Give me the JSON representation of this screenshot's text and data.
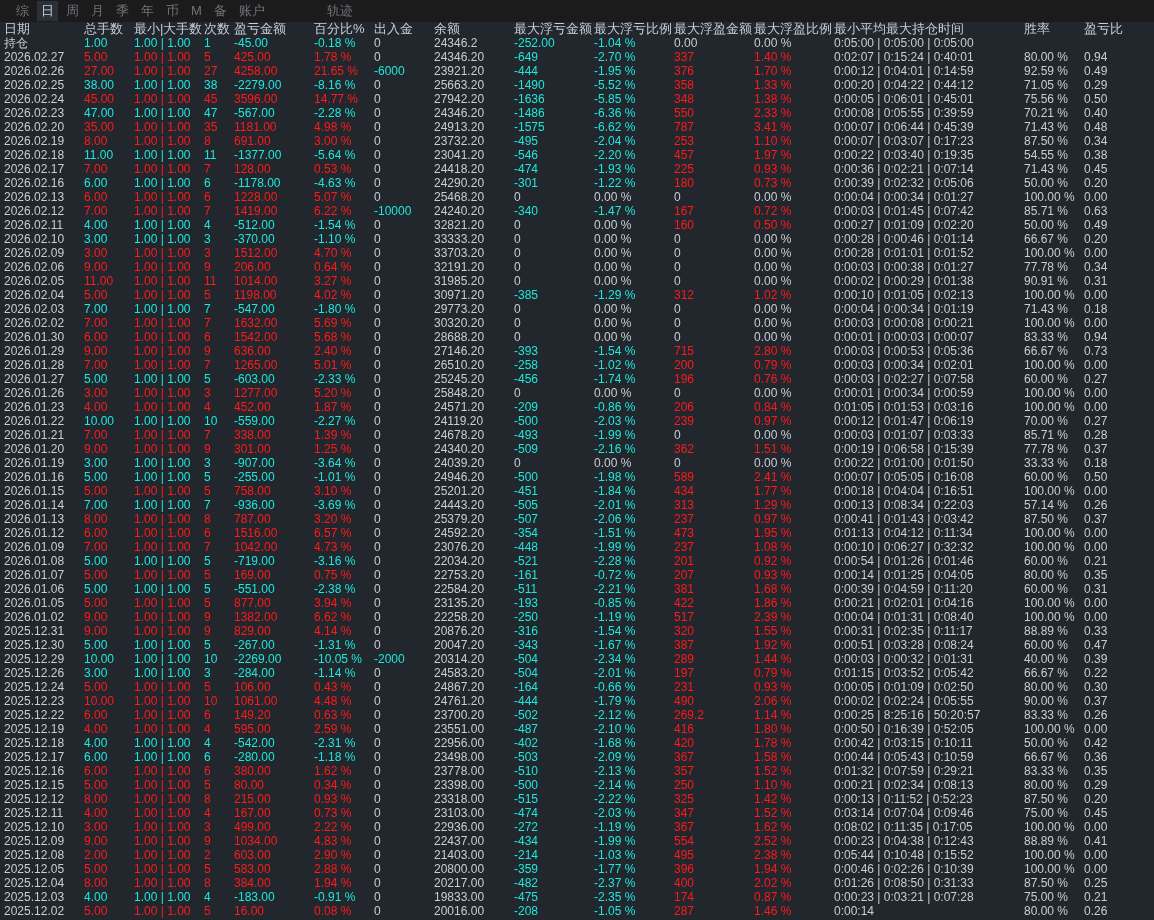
{
  "tabs": [
    {
      "label": "综",
      "selected": false
    },
    {
      "label": "日",
      "selected": true
    },
    {
      "label": "周",
      "selected": false
    },
    {
      "label": "月",
      "selected": false
    },
    {
      "label": "季",
      "selected": false
    },
    {
      "label": "年",
      "selected": false
    },
    {
      "label": "币",
      "selected": false
    },
    {
      "label": "M",
      "selected": false
    },
    {
      "label": "备",
      "selected": false
    },
    {
      "label": "账户",
      "selected": false
    }
  ],
  "extra_tab": {
    "label": "轨迹",
    "selected": false
  },
  "table": {
    "columns": [
      "日期",
      "总手数",
      "最小|大手数",
      "次数",
      "盈亏金额",
      "百分比%",
      "出入金",
      "余额",
      "最大浮亏金额",
      "最大浮亏比例",
      "最大浮盈金额",
      "最大浮盈比例",
      "最小平均最大持仓时间",
      "胜率",
      "盈亏比"
    ],
    "rows": [
      {
        "kind": "loss",
        "withdrawal": false,
        "drawdown": true,
        "runup": false,
        "cells": [
          "持仓",
          "1.00",
          "1.00 | 1.00",
          "1",
          "-45.00",
          "-0.18 %",
          "0",
          "24346.2",
          "-252.00",
          "-1.04 %",
          "0.00",
          "0.00 %",
          "0:05:00 | 0:05:00 | 0:05:00"
        ]
      },
      {
        "kind": "gain",
        "withdrawal": false,
        "drawdown": true,
        "runup": true,
        "cells": [
          "2026.02.27",
          "5.00",
          "1.00 | 1.00",
          "5",
          "425.00",
          "1.78 %",
          "0",
          "24346.20",
          "-649",
          "-2.70 %",
          "337",
          "1.40 %",
          "0:02:07 | 0:15:24 | 0:40:01",
          "80.00 %",
          "0.94"
        ]
      },
      {
        "kind": "gain",
        "withdrawal": true,
        "drawdown": true,
        "runup": true,
        "cells": [
          "2026.02.26",
          "27.00",
          "1.00 | 1.00",
          "27",
          "4258.00",
          "21.65 %",
          "-6000",
          "23921.20",
          "-444",
          "-1.95 %",
          "376",
          "1.70 %",
          "0:00:12 | 0:04:01 | 0:14:59",
          "92.59 %",
          "0.49"
        ]
      },
      {
        "kind": "loss",
        "withdrawal": false,
        "drawdown": true,
        "runup": true,
        "cells": [
          "2026.02.25",
          "38.00",
          "1.00 | 1.00",
          "38",
          "-2279.00",
          "-8.16 %",
          "0",
          "25663.20",
          "-1490",
          "-5.52 %",
          "358",
          "1.33 %",
          "0:00:20 | 0:04:22 | 0:44:12",
          "71.05 %",
          "0.29"
        ]
      },
      {
        "kind": "gain",
        "withdrawal": false,
        "drawdown": true,
        "runup": true,
        "cells": [
          "2026.02.24",
          "45.00",
          "1.00 | 1.00",
          "45",
          "3596.00",
          "14.77 %",
          "0",
          "27942.20",
          "-1636",
          "-5.85 %",
          "348",
          "1.38 %",
          "0:00:05 | 0:06:01 | 0:45:01",
          "75.56 %",
          "0.50"
        ]
      },
      {
        "kind": "loss",
        "withdrawal": false,
        "drawdown": true,
        "runup": true,
        "cells": [
          "2026.02.23",
          "47.00",
          "1.00 | 1.00",
          "47",
          "-567.00",
          "-2.28 %",
          "0",
          "24346.20",
          "-1486",
          "-6.36 %",
          "550",
          "2.33 %",
          "0:00:08 | 0:05:55 | 0:39:59",
          "70.21 %",
          "0.40"
        ]
      },
      {
        "kind": "gain",
        "withdrawal": false,
        "drawdown": true,
        "runup": true,
        "cells": [
          "2026.02.20",
          "35.00",
          "1.00 | 1.00",
          "35",
          "1181.00",
          "4.98 %",
          "0",
          "24913.20",
          "-1575",
          "-6.62 %",
          "787",
          "3.41 %",
          "0:00:07 | 0:06:44 | 0:45:39",
          "71.43 %",
          "0.48"
        ]
      },
      {
        "kind": "gain",
        "withdrawal": false,
        "drawdown": true,
        "runup": true,
        "cells": [
          "2026.02.19",
          "8.00",
          "1.00 | 1.00",
          "8",
          "691.00",
          "3.00 %",
          "0",
          "23732.20",
          "-495",
          "-2.04 %",
          "253",
          "1.10 %",
          "0:00:07 | 0:03:07 | 0:17:23",
          "87.50 %",
          "0.34"
        ]
      },
      {
        "kind": "loss",
        "withdrawal": false,
        "drawdown": true,
        "runup": true,
        "cells": [
          "2026.02.18",
          "11.00",
          "1.00 | 1.00",
          "11",
          "-1377.00",
          "-5.64 %",
          "0",
          "23041.20",
          "-546",
          "-2.20 %",
          "457",
          "1.97 %",
          "0:00:22 | 0:03:40 | 0:19:35",
          "54.55 %",
          "0.38"
        ]
      },
      {
        "kind": "gain",
        "withdrawal": false,
        "drawdown": true,
        "runup": true,
        "cells": [
          "2026.02.17",
          "7.00",
          "1.00 | 1.00",
          "7",
          "128.00",
          "0.53 %",
          "0",
          "24418.20",
          "-474",
          "-1.93 %",
          "225",
          "0.93 %",
          "0:00:36 | 0:02:21 | 0:07:14",
          "71.43 %",
          "0.45"
        ]
      },
      {
        "kind": "loss",
        "withdrawal": false,
        "drawdown": true,
        "runup": true,
        "cells": [
          "2026.02.16",
          "6.00",
          "1.00 | 1.00",
          "6",
          "-1178.00",
          "-4.63 %",
          "0",
          "24290.20",
          "-301",
          "-1.22 %",
          "180",
          "0.73 %",
          "0:00:39 | 0:02:32 | 0:05:06",
          "50.00 %",
          "0.20"
        ]
      },
      {
        "kind": "gain",
        "withdrawal": false,
        "drawdown": false,
        "runup": false,
        "cells": [
          "2026.02.13",
          "6.00",
          "1.00 | 1.00",
          "6",
          "1228.00",
          "5.07 %",
          "0",
          "25468.20",
          "0",
          "0.00 %",
          "0",
          "0.00 %",
          "0:00:04 | 0:00:34 | 0:01:27",
          "100.00 %",
          "0.00"
        ]
      },
      {
        "kind": "gain",
        "withdrawal": true,
        "drawdown": true,
        "runup": true,
        "cells": [
          "2026.02.12",
          "7.00",
          "1.00 | 1.00",
          "7",
          "1419.00",
          "6.22 %",
          "-10000",
          "24240.20",
          "-340",
          "-1.47 %",
          "167",
          "0.72 %",
          "0:00:03 | 0:01:45 | 0:07:42",
          "85.71 %",
          "0.63"
        ]
      },
      {
        "kind": "loss",
        "withdrawal": false,
        "drawdown": false,
        "runup": true,
        "cells": [
          "2026.02.11",
          "4.00",
          "1.00 | 1.00",
          "4",
          "-512.00",
          "-1.54 %",
          "0",
          "32821.20",
          "0",
          "0.00 %",
          "160",
          "0.50 %",
          "0:00:27 | 0:01:09 | 0:02:20",
          "50.00 %",
          "0.49"
        ]
      },
      {
        "kind": "loss",
        "withdrawal": false,
        "drawdown": false,
        "runup": false,
        "cells": [
          "2026.02.10",
          "3.00",
          "1.00 | 1.00",
          "3",
          "-370.00",
          "-1.10 %",
          "0",
          "33333.20",
          "0",
          "0.00 %",
          "0",
          "0.00 %",
          "0:00:28 | 0:00:46 | 0:01:14",
          "66.67 %",
          "0.20"
        ]
      },
      {
        "kind": "gain",
        "withdrawal": false,
        "drawdown": false,
        "runup": false,
        "cells": [
          "2026.02.09",
          "3.00",
          "1.00 | 1.00",
          "3",
          "1512.00",
          "4.70 %",
          "0",
          "33703.20",
          "0",
          "0.00 %",
          "0",
          "0.00 %",
          "0:00:28 | 0:01:01 | 0:01:52",
          "100.00 %",
          "0.00"
        ]
      },
      {
        "kind": "gain",
        "withdrawal": false,
        "drawdown": false,
        "runup": false,
        "cells": [
          "2026.02.06",
          "9.00",
          "1.00 | 1.00",
          "9",
          "206.00",
          "0.64 %",
          "0",
          "32191.20",
          "0",
          "0.00 %",
          "0",
          "0.00 %",
          "0:00:03 | 0:00:38 | 0:01:27",
          "77.78 %",
          "0.34"
        ]
      },
      {
        "kind": "gain",
        "withdrawal": false,
        "drawdown": false,
        "runup": false,
        "cells": [
          "2026.02.05",
          "11.00",
          "1.00 | 1.00",
          "11",
          "1014.00",
          "3.27 %",
          "0",
          "31985.20",
          "0",
          "0.00 %",
          "0",
          "0.00 %",
          "0:00:02 | 0:00:29 | 0:01:38",
          "90.91 %",
          "0.31"
        ]
      },
      {
        "kind": "gain",
        "withdrawal": false,
        "drawdown": true,
        "runup": true,
        "cells": [
          "2026.02.04",
          "5.00",
          "1.00 | 1.00",
          "5",
          "1198.00",
          "4.02 %",
          "0",
          "30971.20",
          "-385",
          "-1.29 %",
          "312",
          "1.02 %",
          "0:00:10 | 0:01:05 | 0:02:13",
          "100.00 %",
          "0.00"
        ]
      },
      {
        "kind": "loss",
        "withdrawal": false,
        "drawdown": false,
        "runup": false,
        "cells": [
          "2026.02.03",
          "7.00",
          "1.00 | 1.00",
          "7",
          "-547.00",
          "-1.80 %",
          "0",
          "29773.20",
          "0",
          "0.00 %",
          "0",
          "0.00 %",
          "0:00:04 | 0:00:34 | 0:01:19",
          "71.43 %",
          "0.18"
        ]
      },
      {
        "kind": "gain",
        "withdrawal": false,
        "drawdown": false,
        "runup": false,
        "cells": [
          "2026.02.02",
          "7.00",
          "1.00 | 1.00",
          "7",
          "1632.00",
          "5.69 %",
          "0",
          "30320.20",
          "0",
          "0.00 %",
          "0",
          "0.00 %",
          "0:00:03 | 0:00:08 | 0:00:21",
          "100.00 %",
          "0.00"
        ]
      },
      {
        "kind": "gain",
        "withdrawal": false,
        "drawdown": false,
        "runup": false,
        "cells": [
          "2026.01.30",
          "6.00",
          "1.00 | 1.00",
          "6",
          "1542.00",
          "5.68 %",
          "0",
          "28688.20",
          "0",
          "0.00 %",
          "0",
          "0.00 %",
          "0:00:01 | 0:00:03 | 0:00:07",
          "83.33 %",
          "0.94"
        ]
      },
      {
        "kind": "gain",
        "withdrawal": false,
        "drawdown": true,
        "runup": true,
        "cells": [
          "2026.01.29",
          "9.00",
          "1.00 | 1.00",
          "9",
          "636.00",
          "2.40 %",
          "0",
          "27146.20",
          "-393",
          "-1.54 %",
          "715",
          "2.80 %",
          "0:00:03 | 0:00:53 | 0:05:36",
          "66.67 %",
          "0.73"
        ]
      },
      {
        "kind": "gain",
        "withdrawal": false,
        "drawdown": true,
        "runup": true,
        "cells": [
          "2026.01.28",
          "7.00",
          "1.00 | 1.00",
          "7",
          "1265.00",
          "5.01 %",
          "0",
          "26510.20",
          "-258",
          "-1.02 %",
          "200",
          "0.79 %",
          "0:00:03 | 0:00:34 | 0:02:01",
          "100.00 %",
          "0.00"
        ]
      },
      {
        "kind": "loss",
        "withdrawal": false,
        "drawdown": true,
        "runup": true,
        "cells": [
          "2026.01.27",
          "5.00",
          "1.00 | 1.00",
          "5",
          "-603.00",
          "-2.33 %",
          "0",
          "25245.20",
          "-456",
          "-1.74 %",
          "196",
          "0.76 %",
          "0:00:03 | 0:02:27 | 0:07:58",
          "60.00 %",
          "0.27"
        ]
      },
      {
        "kind": "gain",
        "withdrawal": false,
        "drawdown": false,
        "runup": false,
        "cells": [
          "2026.01.26",
          "3.00",
          "1.00 | 1.00",
          "3",
          "1277.00",
          "5.20 %",
          "0",
          "25848.20",
          "0",
          "0.00 %",
          "0",
          "0.00 %",
          "0:00:01 | 0:00:34 | 0:00:59",
          "100.00 %",
          "0.00"
        ]
      },
      {
        "kind": "gain",
        "withdrawal": false,
        "drawdown": true,
        "runup": true,
        "cells": [
          "2026.01.23",
          "4.00",
          "1.00 | 1.00",
          "4",
          "452.00",
          "1.87 %",
          "0",
          "24571.20",
          "-209",
          "-0.86 %",
          "206",
          "0.84 %",
          "0:01:05 | 0:01:53 | 0:03:16",
          "100.00 %",
          "0.00"
        ]
      },
      {
        "kind": "loss",
        "withdrawal": false,
        "drawdown": true,
        "runup": true,
        "cells": [
          "2026.01.22",
          "10.00",
          "1.00 | 1.00",
          "10",
          "-559.00",
          "-2.27 %",
          "0",
          "24119.20",
          "-500",
          "-2.03 %",
          "239",
          "0.97 %",
          "0:00:12 | 0:01:47 | 0:06:19",
          "70.00 %",
          "0.27"
        ]
      },
      {
        "kind": "gain",
        "withdrawal": false,
        "drawdown": true,
        "runup": false,
        "cells": [
          "2026.01.21",
          "7.00",
          "1.00 | 1.00",
          "7",
          "338.00",
          "1.39 %",
          "0",
          "24678.20",
          "-493",
          "-1.99 %",
          "0",
          "0.00 %",
          "0:00:03 | 0:01:07 | 0:03:33",
          "85.71 %",
          "0.28"
        ]
      },
      {
        "kind": "gain",
        "withdrawal": false,
        "drawdown": true,
        "runup": true,
        "cells": [
          "2026.01.20",
          "9.00",
          "1.00 | 1.00",
          "9",
          "301.00",
          "1.25 %",
          "0",
          "24340.20",
          "-509",
          "-2.16 %",
          "362",
          "1.51 %",
          "0:00:19 | 0:06:58 | 0:15:39",
          "77.78 %",
          "0.37"
        ]
      },
      {
        "kind": "loss",
        "withdrawal": false,
        "drawdown": false,
        "runup": false,
        "cells": [
          "2026.01.19",
          "3.00",
          "1.00 | 1.00",
          "3",
          "-907.00",
          "-3.64 %",
          "0",
          "24039.20",
          "0",
          "0.00 %",
          "0",
          "0.00 %",
          "0:00:22 | 0:01:00 | 0:01:50",
          "33.33 %",
          "0.18"
        ]
      },
      {
        "kind": "loss",
        "withdrawal": false,
        "drawdown": true,
        "runup": true,
        "cells": [
          "2026.01.16",
          "5.00",
          "1.00 | 1.00",
          "5",
          "-255.00",
          "-1.01 %",
          "0",
          "24946.20",
          "-500",
          "-1.98 %",
          "589",
          "2.41 %",
          "0:00:07 | 0:05:05 | 0:16:08",
          "60.00 %",
          "0.50"
        ]
      },
      {
        "kind": "gain",
        "withdrawal": false,
        "drawdown": true,
        "runup": true,
        "cells": [
          "2026.01.15",
          "5.00",
          "1.00 | 1.00",
          "5",
          "758.00",
          "3.10 %",
          "0",
          "25201.20",
          "-451",
          "-1.84 %",
          "434",
          "1.77 %",
          "0:00:18 | 0:04:04 | 0:16:51",
          "100.00 %",
          "0.00"
        ]
      },
      {
        "kind": "loss",
        "withdrawal": false,
        "drawdown": true,
        "runup": true,
        "cells": [
          "2026.01.14",
          "7.00",
          "1.00 | 1.00",
          "7",
          "-936.00",
          "-3.69 %",
          "0",
          "24443.20",
          "-505",
          "-2.01 %",
          "313",
          "1.29 %",
          "0:00:13 | 0:08:34 | 0:22:03",
          "57.14 %",
          "0.26"
        ]
      },
      {
        "kind": "gain",
        "withdrawal": false,
        "drawdown": true,
        "runup": true,
        "cells": [
          "2026.01.13",
          "8.00",
          "1.00 | 1.00",
          "8",
          "787.00",
          "3.20 %",
          "0",
          "25379.20",
          "-507",
          "-2.06 %",
          "237",
          "0.97 %",
          "0:00:41 | 0:01:43 | 0:03:42",
          "87.50 %",
          "0.37"
        ]
      },
      {
        "kind": "gain",
        "withdrawal": false,
        "drawdown": true,
        "runup": true,
        "cells": [
          "2026.01.12",
          "6.00",
          "1.00 | 1.00",
          "6",
          "1516.00",
          "6.57 %",
          "0",
          "24592.20",
          "-354",
          "-1.51 %",
          "473",
          "1.95 %",
          "0:01:13 | 0:04:12 | 0:11:34",
          "100.00 %",
          "0.00"
        ]
      },
      {
        "kind": "gain",
        "withdrawal": false,
        "drawdown": true,
        "runup": true,
        "cells": [
          "2026.01.09",
          "7.00",
          "1.00 | 1.00",
          "7",
          "1042.00",
          "4.73 %",
          "0",
          "23076.20",
          "-448",
          "-1.99 %",
          "237",
          "1.08 %",
          "0:00:10 | 0:06:27 | 0:32:32",
          "100.00 %",
          "0.00"
        ]
      },
      {
        "kind": "loss",
        "withdrawal": false,
        "drawdown": true,
        "runup": true,
        "cells": [
          "2026.01.08",
          "5.00",
          "1.00 | 1.00",
          "5",
          "-719.00",
          "-3.16 %",
          "0",
          "22034.20",
          "-521",
          "-2.28 %",
          "201",
          "0.92 %",
          "0:00:54 | 0:01:26 | 0:01:46",
          "60.00 %",
          "0.21"
        ]
      },
      {
        "kind": "gain",
        "withdrawal": false,
        "drawdown": true,
        "runup": true,
        "cells": [
          "2026.01.07",
          "5.00",
          "1.00 | 1.00",
          "5",
          "169.00",
          "0.75 %",
          "0",
          "22753.20",
          "-161",
          "-0.72 %",
          "207",
          "0.93 %",
          "0:00:14 | 0:01:25 | 0:04:05",
          "80.00 %",
          "0.35"
        ]
      },
      {
        "kind": "loss",
        "withdrawal": false,
        "drawdown": true,
        "runup": true,
        "cells": [
          "2026.01.06",
          "5.00",
          "1.00 | 1.00",
          "5",
          "-551.00",
          "-2.38 %",
          "0",
          "22584.20",
          "-511",
          "-2.21 %",
          "381",
          "1.68 %",
          "0:00:39 | 0:04:59 | 0:11:20",
          "60.00 %",
          "0.31"
        ]
      },
      {
        "kind": "gain",
        "withdrawal": false,
        "drawdown": true,
        "runup": true,
        "cells": [
          "2026.01.05",
          "5.00",
          "1.00 | 1.00",
          "5",
          "877.00",
          "3.94 %",
          "0",
          "23135.20",
          "-193",
          "-0.85 %",
          "422",
          "1.86 %",
          "0:00:21 | 0:02:01 | 0:04:16",
          "100.00 %",
          "0.00"
        ]
      },
      {
        "kind": "gain",
        "withdrawal": false,
        "drawdown": true,
        "runup": true,
        "cells": [
          "2026.01.02",
          "9.00",
          "1.00 | 1.00",
          "9",
          "1382.00",
          "6.62 %",
          "0",
          "22258.20",
          "-250",
          "-1.19 %",
          "517",
          "2.39 %",
          "0:00:04 | 0:01:31 | 0:08:40",
          "100.00 %",
          "0.00"
        ]
      },
      {
        "kind": "gain",
        "withdrawal": false,
        "drawdown": true,
        "runup": true,
        "cells": [
          "2025.12.31",
          "9.00",
          "1.00 | 1.00",
          "9",
          "829.00",
          "4.14 %",
          "0",
          "20876.20",
          "-316",
          "-1.54 %",
          "320",
          "1.55 %",
          "0:00:31 | 0:02:35 | 0:11:17",
          "88.89 %",
          "0.33"
        ]
      },
      {
        "kind": "loss",
        "withdrawal": false,
        "drawdown": true,
        "runup": true,
        "cells": [
          "2025.12.30",
          "5.00",
          "1.00 | 1.00",
          "5",
          "-267.00",
          "-1.31 %",
          "0",
          "20047.20",
          "-343",
          "-1.67 %",
          "387",
          "1.92 %",
          "0:00:51 | 0:03:28 | 0:08:24",
          "60.00 %",
          "0.47"
        ]
      },
      {
        "kind": "loss",
        "withdrawal": true,
        "drawdown": true,
        "runup": true,
        "cells": [
          "2025.12.29",
          "10.00",
          "1.00 | 1.00",
          "10",
          "-2269.00",
          "-10.05 %",
          "-2000",
          "20314.20",
          "-504",
          "-2.34 %",
          "289",
          "1.44 %",
          "0:00:03 | 0:00:32 | 0:01:31",
          "40.00 %",
          "0.39"
        ]
      },
      {
        "kind": "loss",
        "withdrawal": false,
        "drawdown": true,
        "runup": true,
        "cells": [
          "2025.12.26",
          "3.00",
          "1.00 | 1.00",
          "3",
          "-284.00",
          "-1.14 %",
          "0",
          "24583.20",
          "-504",
          "-2.01 %",
          "197",
          "0.79 %",
          "0:01:15 | 0:03:52 | 0:05:42",
          "66.67 %",
          "0.22"
        ]
      },
      {
        "kind": "gain",
        "withdrawal": false,
        "drawdown": true,
        "runup": true,
        "cells": [
          "2025.12.24",
          "5.00",
          "1.00 | 1.00",
          "5",
          "106.00",
          "0.43 %",
          "0",
          "24867.20",
          "-164",
          "-0.66 %",
          "231",
          "0.93 %",
          "0:00:05 | 0:01:09 | 0:02:50",
          "80.00 %",
          "0.30"
        ]
      },
      {
        "kind": "gain",
        "withdrawal": false,
        "drawdown": true,
        "runup": true,
        "cells": [
          "2025.12.23",
          "10.00",
          "1.00 | 1.00",
          "10",
          "1061.00",
          "4.48 %",
          "0",
          "24761.20",
          "-444",
          "-1.79 %",
          "490",
          "2.06 %",
          "0:00:02 | 0:02:24 | 0:05:55",
          "90.00 %",
          "0.37"
        ]
      },
      {
        "kind": "gain",
        "withdrawal": false,
        "drawdown": true,
        "runup": true,
        "cells": [
          "2025.12.22",
          "6.00",
          "1.00 | 1.00",
          "6",
          "149.20",
          "0.63 %",
          "0",
          "23700.20",
          "-502",
          "-2.12 %",
          "269.2",
          "1.14 %",
          "0:00:25 | 8:25:16 | 50:20:57",
          "83.33 %",
          "0.26"
        ]
      },
      {
        "kind": "gain",
        "withdrawal": false,
        "drawdown": true,
        "runup": true,
        "cells": [
          "2025.12.19",
          "4.00",
          "1.00 | 1.00",
          "4",
          "595.00",
          "2.59 %",
          "0",
          "23551.00",
          "-487",
          "-2.10 %",
          "416",
          "1.80 %",
          "0:00:50 | 0:16:39 | 0:52:05",
          "100.00 %",
          "0.00"
        ]
      },
      {
        "kind": "loss",
        "withdrawal": false,
        "drawdown": true,
        "runup": true,
        "cells": [
          "2025.12.18",
          "4.00",
          "1.00 | 1.00",
          "4",
          "-542.00",
          "-2.31 %",
          "0",
          "22956.00",
          "-402",
          "-1.68 %",
          "420",
          "1.78 %",
          "0:00:42 | 0:03:15 | 0:10:11",
          "50.00 %",
          "0.42"
        ]
      },
      {
        "kind": "loss",
        "withdrawal": false,
        "drawdown": true,
        "runup": true,
        "cells": [
          "2025.12.17",
          "6.00",
          "1.00 | 1.00",
          "6",
          "-280.00",
          "-1.18 %",
          "0",
          "23498.00",
          "-503",
          "-2.09 %",
          "367",
          "1.58 %",
          "0:00:44 | 0:05:43 | 0:10:59",
          "66.67 %",
          "0.36"
        ]
      },
      {
        "kind": "gain",
        "withdrawal": false,
        "drawdown": true,
        "runup": true,
        "cells": [
          "2025.12.16",
          "6.00",
          "1.00 | 1.00",
          "6",
          "380.00",
          "1.62 %",
          "0",
          "23778.00",
          "-510",
          "-2.13 %",
          "357",
          "1.52 %",
          "0:01:32 | 0:07:59 | 0:29:21",
          "83.33 %",
          "0.35"
        ]
      },
      {
        "kind": "gain",
        "withdrawal": false,
        "drawdown": true,
        "runup": true,
        "cells": [
          "2025.12.15",
          "5.00",
          "1.00 | 1.00",
          "5",
          "80.00",
          "0.34 %",
          "0",
          "23398.00",
          "-500",
          "-2.14 %",
          "250",
          "1.10 %",
          "0:00:21 | 0:02:34 | 0:08:13",
          "80.00 %",
          "0.29"
        ]
      },
      {
        "kind": "gain",
        "withdrawal": false,
        "drawdown": true,
        "runup": true,
        "cells": [
          "2025.12.12",
          "8.00",
          "1.00 | 1.00",
          "8",
          "215.00",
          "0.93 %",
          "0",
          "23318.00",
          "-515",
          "-2.22 %",
          "325",
          "1.42 %",
          "0:00:13 | 0:11:52 | 0:52:23",
          "87.50 %",
          "0.20"
        ]
      },
      {
        "kind": "gain",
        "withdrawal": false,
        "drawdown": true,
        "runup": true,
        "cells": [
          "2025.12.11",
          "4.00",
          "1.00 | 1.00",
          "4",
          "167.00",
          "0.73 %",
          "0",
          "23103.00",
          "-474",
          "-2.03 %",
          "347",
          "1.52 %",
          "0:03:14 | 0:07:04 | 0:09:46",
          "75.00 %",
          "0.45"
        ]
      },
      {
        "kind": "gain",
        "withdrawal": false,
        "drawdown": true,
        "runup": true,
        "cells": [
          "2025.12.10",
          "3.00",
          "1.00 | 1.00",
          "3",
          "499.00",
          "2.22 %",
          "0",
          "22936.00",
          "-272",
          "-1.19 %",
          "367",
          "1.62 %",
          "0:08:02 | 0:11:35 | 0:17:05",
          "100.00 %",
          "0.00"
        ]
      },
      {
        "kind": "gain",
        "withdrawal": false,
        "drawdown": true,
        "runup": true,
        "cells": [
          "2025.12.09",
          "9.00",
          "1.00 | 1.00",
          "9",
          "1034.00",
          "4.83 %",
          "0",
          "22437.00",
          "-434",
          "-1.99 %",
          "554",
          "2.52 %",
          "0:00:23 | 0:04:38 | 0:12:43",
          "88.89 %",
          "0.41"
        ]
      },
      {
        "kind": "gain",
        "withdrawal": false,
        "drawdown": true,
        "runup": true,
        "cells": [
          "2025.12.08",
          "2.00",
          "1.00 | 1.00",
          "2",
          "603.00",
          "2.90 %",
          "0",
          "21403.00",
          "-214",
          "-1.03 %",
          "495",
          "2.38 %",
          "0:05:44 | 0:10:48 | 0:15:52",
          "100.00 %",
          "0.00"
        ]
      },
      {
        "kind": "gain",
        "withdrawal": false,
        "drawdown": true,
        "runup": true,
        "cells": [
          "2025.12.05",
          "5.00",
          "1.00 | 1.00",
          "5",
          "583.00",
          "2.88 %",
          "0",
          "20800.00",
          "-359",
          "-1.77 %",
          "396",
          "1.94 %",
          "0:00:46 | 0:02:26 | 0:10:39",
          "100.00 %",
          "0.00"
        ]
      },
      {
        "kind": "gain",
        "withdrawal": false,
        "drawdown": true,
        "runup": true,
        "cells": [
          "2025.12.04",
          "8.00",
          "1.00 | 1.00",
          "8",
          "384.00",
          "1.94 %",
          "0",
          "20217.00",
          "-482",
          "-2.37 %",
          "400",
          "2.02 %",
          "0:01:26 | 0:08:50 | 0:31:33",
          "87.50 %",
          "0.25"
        ]
      },
      {
        "kind": "loss",
        "withdrawal": false,
        "drawdown": true,
        "runup": true,
        "cells": [
          "2025.12.03",
          "4.00",
          "1.00 | 1.00",
          "4",
          "-183.00",
          "-0.91 %",
          "0",
          "19833.00",
          "-475",
          "-2.35 %",
          "174",
          "0.87 %",
          "0:00:23 | 0:03:21 | 0:07:28",
          "75.00 %",
          "0.21"
        ]
      },
      {
        "kind": "gain",
        "withdrawal": false,
        "drawdown": true,
        "runup": true,
        "cells": [
          "2025.12.02",
          "5.00",
          "1.00 | 1.00",
          "5",
          "16.00",
          "0.08 %",
          "0",
          "20016.00",
          "-208",
          "-1.05 %",
          "287",
          "1.46 %",
          "0:00:14",
          "80.00 %",
          "0.26"
        ]
      }
    ]
  }
}
